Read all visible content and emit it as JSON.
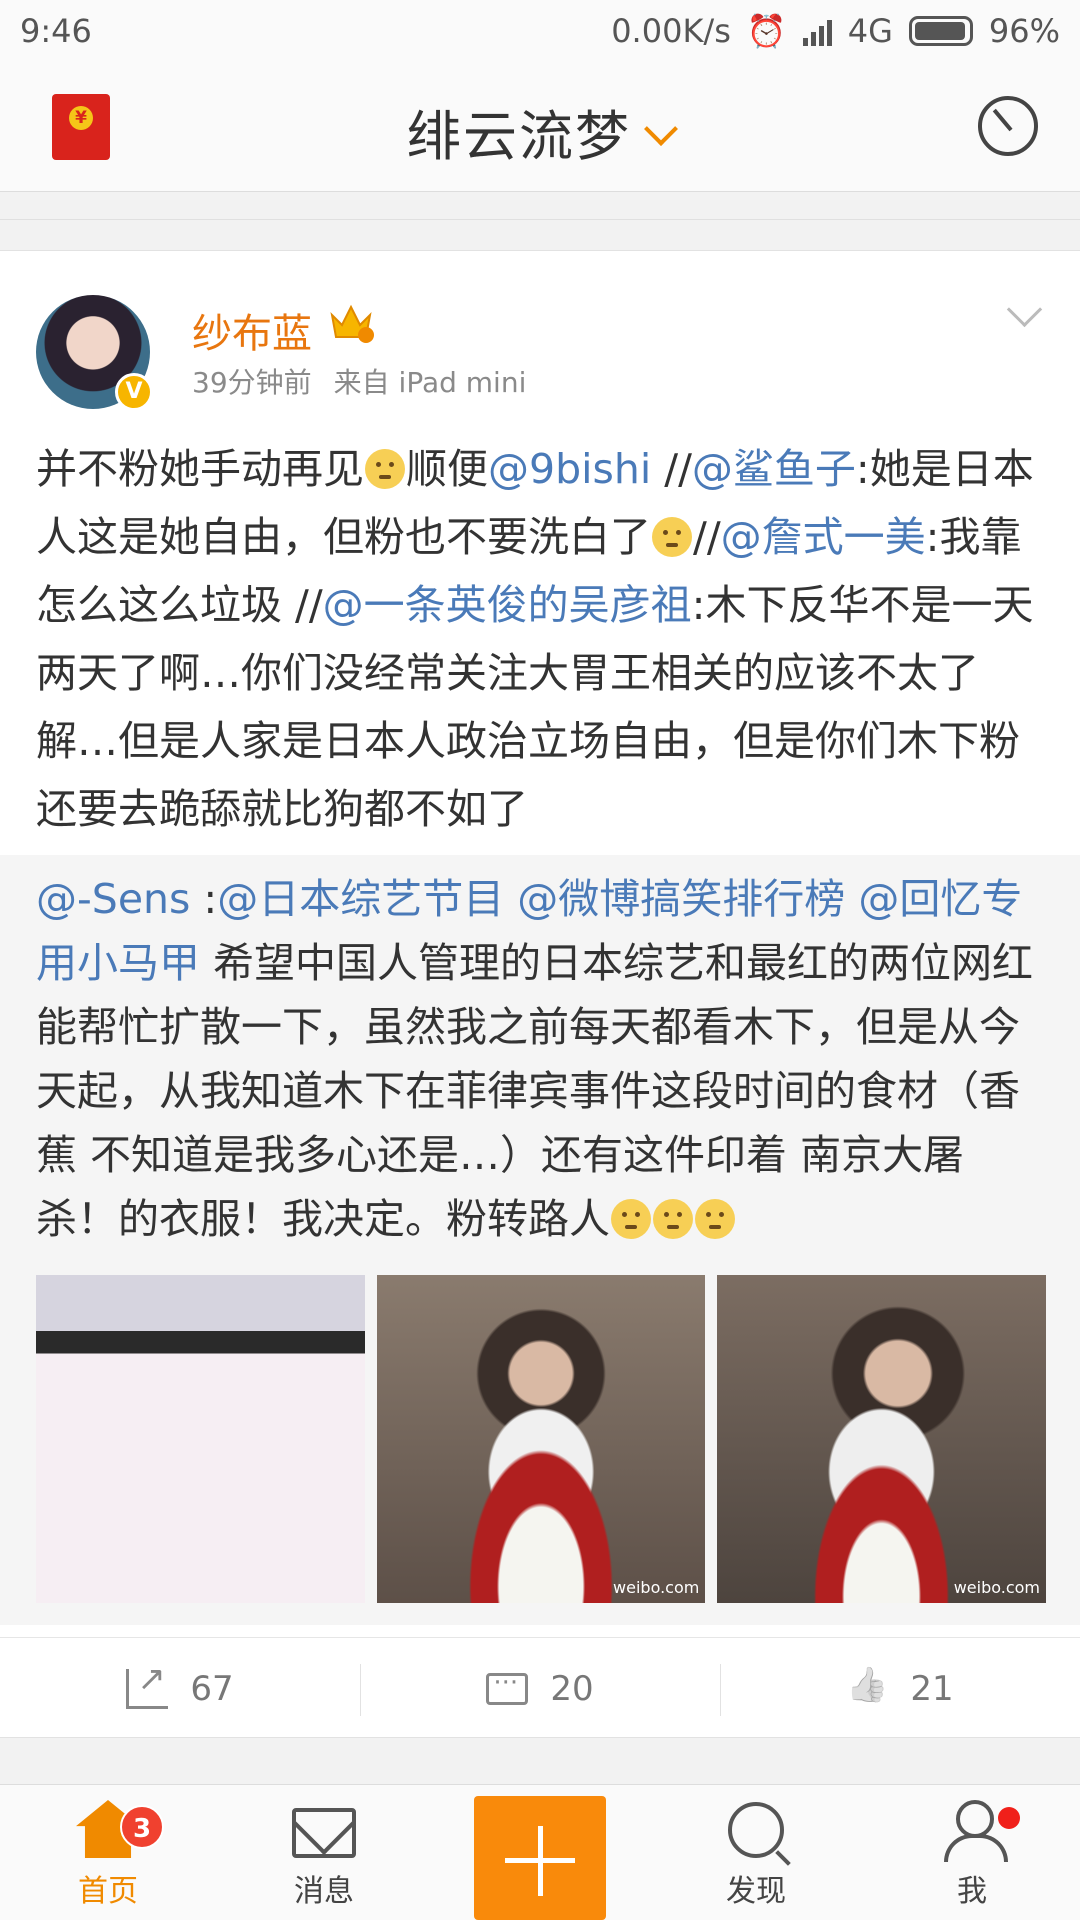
{
  "status": {
    "time": "9:46",
    "speed": "0.00K/s",
    "network": "4G",
    "battery": "96%"
  },
  "header": {
    "title": "绯云流梦"
  },
  "post": {
    "username": "纱布蓝",
    "time": "39分钟前",
    "source": "来自 iPad mini",
    "text": {
      "t1": "并不粉她手动再见",
      "t2": "顺便",
      "m1": "@9bishi",
      "t3": " //",
      "m2": "@鲨鱼子",
      "t4": ":她是日本人这是她自由，但粉也不要洗白了",
      "t5": "//",
      "m3": "@詹式一美",
      "t6": ":我靠怎么这么垃圾 //",
      "m4": "@一条英俊的吴彦祖",
      "t7": ":木下反华不是一天两天了啊…你们没经常关注大胃王相关的应该不太了解…但是人家是日本人政治立场自由，但是你们木下粉还要去跪舔就比狗都不如了"
    },
    "repost": {
      "m1": "@-Sens",
      "t1": " :",
      "m2": "@日本综艺节目",
      "t2": " ",
      "m3": "@微博搞笑排行榜",
      "t3": " ",
      "m4": "@回忆专用小马甲",
      "t4": " 希望中国人管理的日本综艺和最红的两位网红能帮忙扩散一下，虽然我之前每天都看木下，但是从今天起，从我知道木下在菲律宾事件这段时间的食材（香蕉 不知道是我多心还是…）还有这件印着 南京大屠杀！的衣服！我决定。粉转路人",
      "thumbs": [
        "thumb-app-screenshot",
        "thumb-video-eating",
        "thumb-video-eating-2"
      ],
      "watermark": "weibo.com"
    },
    "actions": {
      "share_count": "67",
      "comment_count": "20",
      "like_count": "21"
    }
  },
  "nav": {
    "home": "首页",
    "home_badge": "3",
    "messages": "消息",
    "discover": "发现",
    "me": "我"
  },
  "colors": {
    "accent": "#f08a00",
    "link": "#4a7ab8",
    "username": "#e8760f"
  }
}
